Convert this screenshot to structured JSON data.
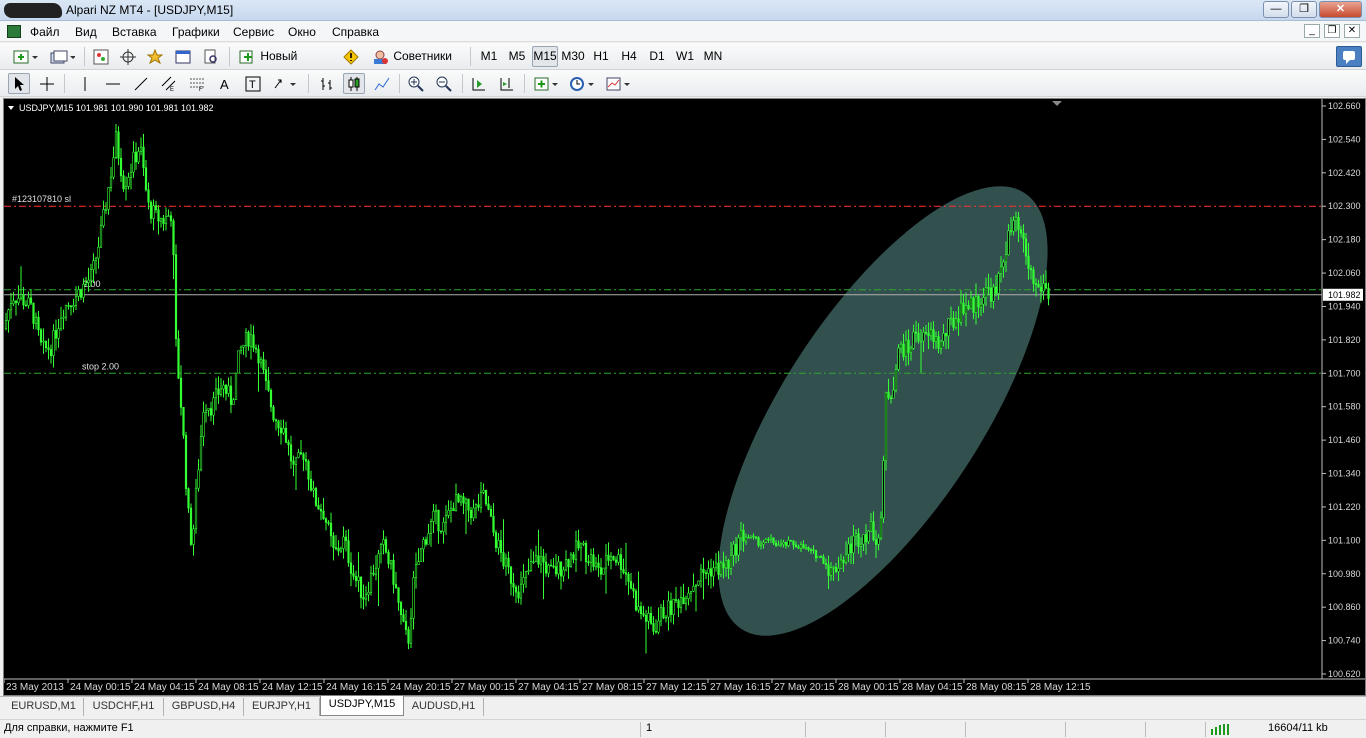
{
  "window": {
    "title": "Alpari NZ MT4 - [USDJPY,M15]"
  },
  "menu": [
    "Файл",
    "Вид",
    "Вставка",
    "Графики",
    "Сервис",
    "Окно",
    "Справка"
  ],
  "toolbar": {
    "new_order_label": "Новый Ордер",
    "experts_label": "Советники",
    "timeframes": [
      "M1",
      "M5",
      "M15",
      "M30",
      "H1",
      "H4",
      "D1",
      "W1",
      "MN"
    ],
    "active_timeframe": "M15"
  },
  "chart": {
    "header": "USDJPY,M15  101.981 101.990 101.981 101.982",
    "order_label": "#123107810 sl",
    "tp_label": "2.00",
    "stop_label": "stop 2.00",
    "current_price": "101.982",
    "colors": {
      "background": "#000000",
      "candle": "#33ff33",
      "sl_line": "#ff3030",
      "grid_line": "#2fa82f",
      "highlight": "#355452"
    }
  },
  "chart_data": {
    "type": "candlestick",
    "symbol": "USDJPY",
    "timeframe": "M15",
    "y_ticks": [
      "102.660",
      "102.540",
      "102.420",
      "102.300",
      "102.180",
      "102.060",
      "101.940",
      "101.820",
      "101.700",
      "101.580",
      "101.460",
      "101.340",
      "101.220",
      "101.100",
      "100.980",
      "100.860",
      "100.740",
      "100.620"
    ],
    "ylim": [
      100.6,
      102.68
    ],
    "x_ticks": [
      "23 May 2013",
      "24 May 00:15",
      "24 May 04:15",
      "24 May 08:15",
      "24 May 12:15",
      "24 May 16:15",
      "24 May 20:15",
      "27 May 00:15",
      "27 May 04:15",
      "27 May 08:15",
      "27 May 12:15",
      "27 May 16:15",
      "27 May 20:15",
      "28 May 00:15",
      "28 May 04:15",
      "28 May 08:15",
      "28 May 12:15"
    ],
    "levels": [
      {
        "name": "stop loss",
        "price": 102.3
      },
      {
        "name": "take profit",
        "price": 102.0
      },
      {
        "name": "current",
        "price": 101.982
      },
      {
        "name": "stop",
        "price": 101.7
      }
    ],
    "path": [
      [
        0,
        101.86
      ],
      [
        8,
        101.98
      ],
      [
        18,
        101.97
      ],
      [
        28,
        101.93
      ],
      [
        38,
        101.78
      ],
      [
        48,
        101.8
      ],
      [
        58,
        101.93
      ],
      [
        72,
        101.98
      ],
      [
        88,
        102.05
      ],
      [
        98,
        102.22
      ],
      [
        106,
        102.4
      ],
      [
        112,
        102.54
      ],
      [
        120,
        102.38
      ],
      [
        128,
        102.45
      ],
      [
        136,
        102.52
      ],
      [
        144,
        102.3
      ],
      [
        152,
        102.26
      ],
      [
        160,
        102.25
      ],
      [
        168,
        102.28
      ],
      [
        172,
        101.8
      ],
      [
        178,
        101.55
      ],
      [
        184,
        101.2
      ],
      [
        188,
        101.08
      ],
      [
        194,
        101.35
      ],
      [
        200,
        101.6
      ],
      [
        208,
        101.58
      ],
      [
        218,
        101.66
      ],
      [
        228,
        101.6
      ],
      [
        236,
        101.78
      ],
      [
        246,
        101.84
      ],
      [
        254,
        101.78
      ],
      [
        262,
        101.65
      ],
      [
        270,
        101.55
      ],
      [
        280,
        101.5
      ],
      [
        290,
        101.35
      ],
      [
        300,
        101.42
      ],
      [
        310,
        101.25
      ],
      [
        320,
        101.2
      ],
      [
        330,
        101.05
      ],
      [
        340,
        101.1
      ],
      [
        350,
        100.97
      ],
      [
        360,
        100.9
      ],
      [
        370,
        101.0
      ],
      [
        380,
        101.08
      ],
      [
        390,
        100.96
      ],
      [
        398,
        100.8
      ],
      [
        404,
        100.73
      ],
      [
        410,
        100.96
      ],
      [
        420,
        101.1
      ],
      [
        430,
        101.18
      ],
      [
        440,
        101.15
      ],
      [
        450,
        101.24
      ],
      [
        460,
        101.22
      ],
      [
        470,
        101.2
      ],
      [
        480,
        101.26
      ],
      [
        490,
        101.12
      ],
      [
        500,
        101.02
      ],
      [
        508,
        100.96
      ],
      [
        516,
        100.92
      ],
      [
        526,
        101.0
      ],
      [
        536,
        101.04
      ],
      [
        546,
        100.98
      ],
      [
        556,
        101.0
      ],
      [
        566,
        101.04
      ],
      [
        576,
        101.08
      ],
      [
        586,
        101.04
      ],
      [
        596,
        100.98
      ],
      [
        606,
        101.05
      ],
      [
        616,
        101.03
      ],
      [
        626,
        100.95
      ],
      [
        634,
        100.85
      ],
      [
        642,
        100.82
      ],
      [
        650,
        100.78
      ],
      [
        658,
        100.84
      ],
      [
        668,
        100.86
      ],
      [
        678,
        100.9
      ],
      [
        688,
        100.94
      ],
      [
        698,
        100.98
      ],
      [
        708,
        101.0
      ],
      [
        718,
        101.0
      ],
      [
        726,
        101.02
      ],
      [
        732,
        101.08
      ],
      [
        738,
        101.12
      ],
      [
        746,
        101.11
      ],
      [
        756,
        101.09
      ],
      [
        766,
        101.1
      ],
      [
        776,
        101.08
      ],
      [
        786,
        101.09
      ],
      [
        796,
        101.08
      ],
      [
        806,
        101.06
      ],
      [
        816,
        101.04
      ],
      [
        822,
        101.02
      ],
      [
        828,
        100.98
      ],
      [
        834,
        101.02
      ],
      [
        842,
        101.05
      ],
      [
        850,
        101.1
      ],
      [
        858,
        101.12
      ],
      [
        866,
        101.14
      ],
      [
        874,
        101.11
      ],
      [
        878,
        101.2
      ],
      [
        882,
        101.62
      ],
      [
        888,
        101.64
      ],
      [
        896,
        101.8
      ],
      [
        904,
        101.78
      ],
      [
        912,
        101.85
      ],
      [
        920,
        101.82
      ],
      [
        928,
        101.84
      ],
      [
        936,
        101.8
      ],
      [
        944,
        101.86
      ],
      [
        952,
        101.9
      ],
      [
        960,
        101.95
      ],
      [
        968,
        101.94
      ],
      [
        976,
        101.97
      ],
      [
        984,
        102.0
      ],
      [
        992,
        101.98
      ],
      [
        998,
        102.1
      ],
      [
        1004,
        102.18
      ],
      [
        1010,
        102.24
      ],
      [
        1016,
        102.2
      ],
      [
        1022,
        102.12
      ],
      [
        1028,
        102.04
      ],
      [
        1034,
        102.0
      ],
      [
        1040,
        102.02
      ],
      [
        1046,
        101.97
      ]
    ]
  },
  "tabs": [
    "EURUSD,M1",
    "USDCHF,H1",
    "GBPUSD,H4",
    "EURJPY,H1",
    "USDJPY,M15",
    "AUDUSD,H1"
  ],
  "active_tab": "USDJPY,M15",
  "status": {
    "help": "Для справки, нажмите F1",
    "profile": "1",
    "traffic": "16604/11 kb"
  }
}
